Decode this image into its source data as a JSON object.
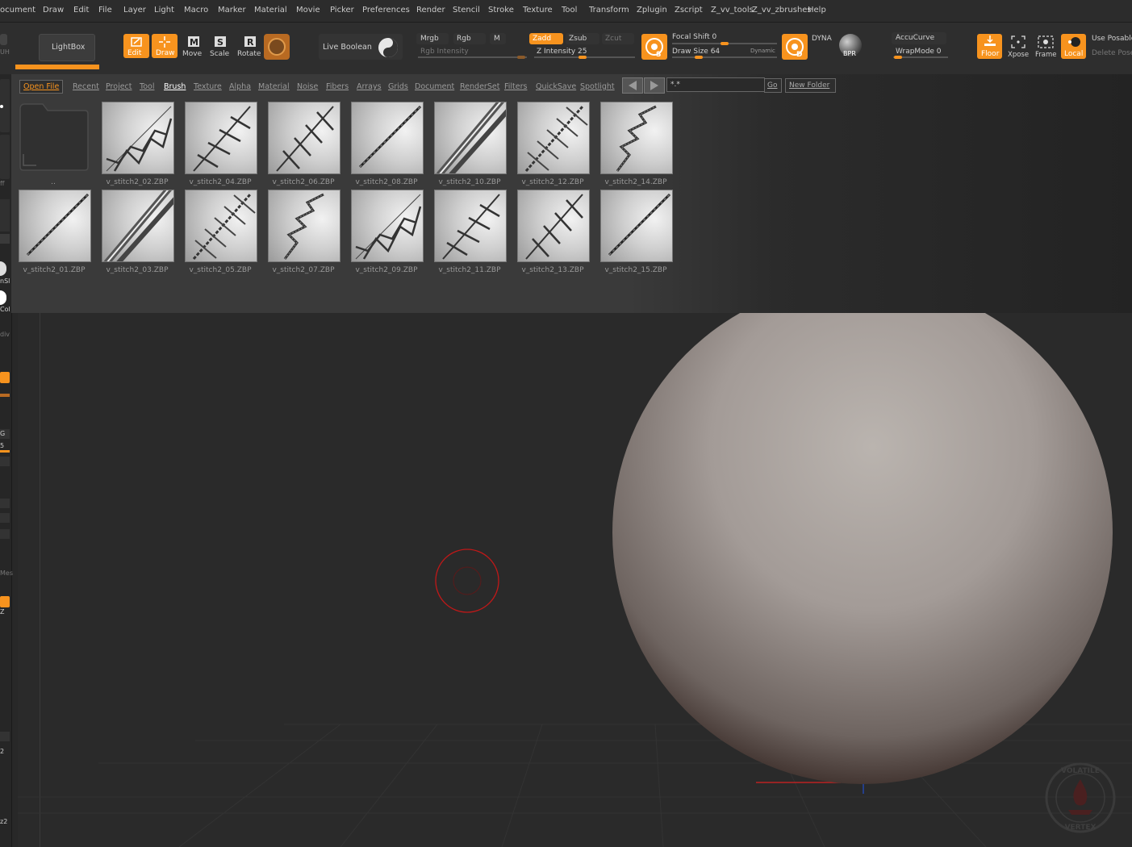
{
  "menu": {
    "items": [
      "ocument",
      "Draw",
      "Edit",
      "File",
      "Layer",
      "Light",
      "Macro",
      "Marker",
      "Material",
      "Movie",
      "Picker",
      "Preferences",
      "Render",
      "Stencil",
      "Stroke",
      "Texture",
      "Tool",
      "Transform",
      "Zplugin",
      "Zscript",
      "Z_vv_tools",
      "Z_vv_zbrushes",
      "Help"
    ]
  },
  "toolbar": {
    "lightbox": "LightBox",
    "edit": "Edit",
    "draw": "Draw",
    "move": "Move",
    "scale": "Scale",
    "rotate": "Rotate",
    "live_boolean": "Live Boolean",
    "mrgb": "Mrgb",
    "rgb": "Rgb",
    "m": "M",
    "rgb_intensity": "Rgb Intensity",
    "zadd": "Zadd",
    "zsub": "Zsub",
    "zcut": "Zcut",
    "z_intensity": "Z Intensity 25",
    "focal_shift": "Focal Shift 0",
    "draw_size": "Draw Size 64",
    "dynamic": "Dynamic",
    "dyna": "DYNA",
    "bpr": "BPR",
    "accucurve": "AccuCurve",
    "wrapmode": "WrapMode 0",
    "floor": "Floor",
    "xpose": "Xpose",
    "frame": "Frame",
    "local": "Local",
    "use_posable": "Use Posable",
    "delete_pose": "Delete Pose",
    "left_stub": "UH"
  },
  "lightbox": {
    "tabs": [
      "Open File",
      "Recent",
      "Project",
      "Tool",
      "Brush",
      "Texture",
      "Alpha",
      "Material",
      "Noise",
      "Fibers",
      "Arrays",
      "Grids",
      "Document",
      "RenderSet",
      "Filters",
      "QuickSave",
      "Spotlight"
    ],
    "active_tab": "Brush",
    "search_value": "*.*",
    "go": "Go",
    "new_folder": "New Folder",
    "parent_folder": "..",
    "row1": [
      "v_stitch2_02.ZBP",
      "v_stitch2_04.ZBP",
      "v_stitch2_06.ZBP",
      "v_stitch2_08.ZBP",
      "v_stitch2_10.ZBP",
      "v_stitch2_12.ZBP",
      "v_stitch2_14.ZBP"
    ],
    "row2": [
      "v_stitch2_01.ZBP",
      "v_stitch2_03.ZBP",
      "v_stitch2_05.ZBP",
      "v_stitch2_07.ZBP",
      "v_stitch2_09.ZBP",
      "v_stitch2_11.ZBP",
      "v_stitch2_13.ZBP",
      "v_stitch2_15.ZBP"
    ]
  },
  "left_panel": {
    "labels": [
      "ff",
      "nSl",
      "Col",
      "div",
      "5",
      "G",
      "Mes",
      "Z",
      "2",
      "z2"
    ]
  },
  "watermark": {
    "top": "VOLATILE",
    "bottom": "VERTEX"
  },
  "colors": {
    "accent": "#f7931e",
    "canvas": "#2a2a2a",
    "sphere": "#a8a19e"
  }
}
